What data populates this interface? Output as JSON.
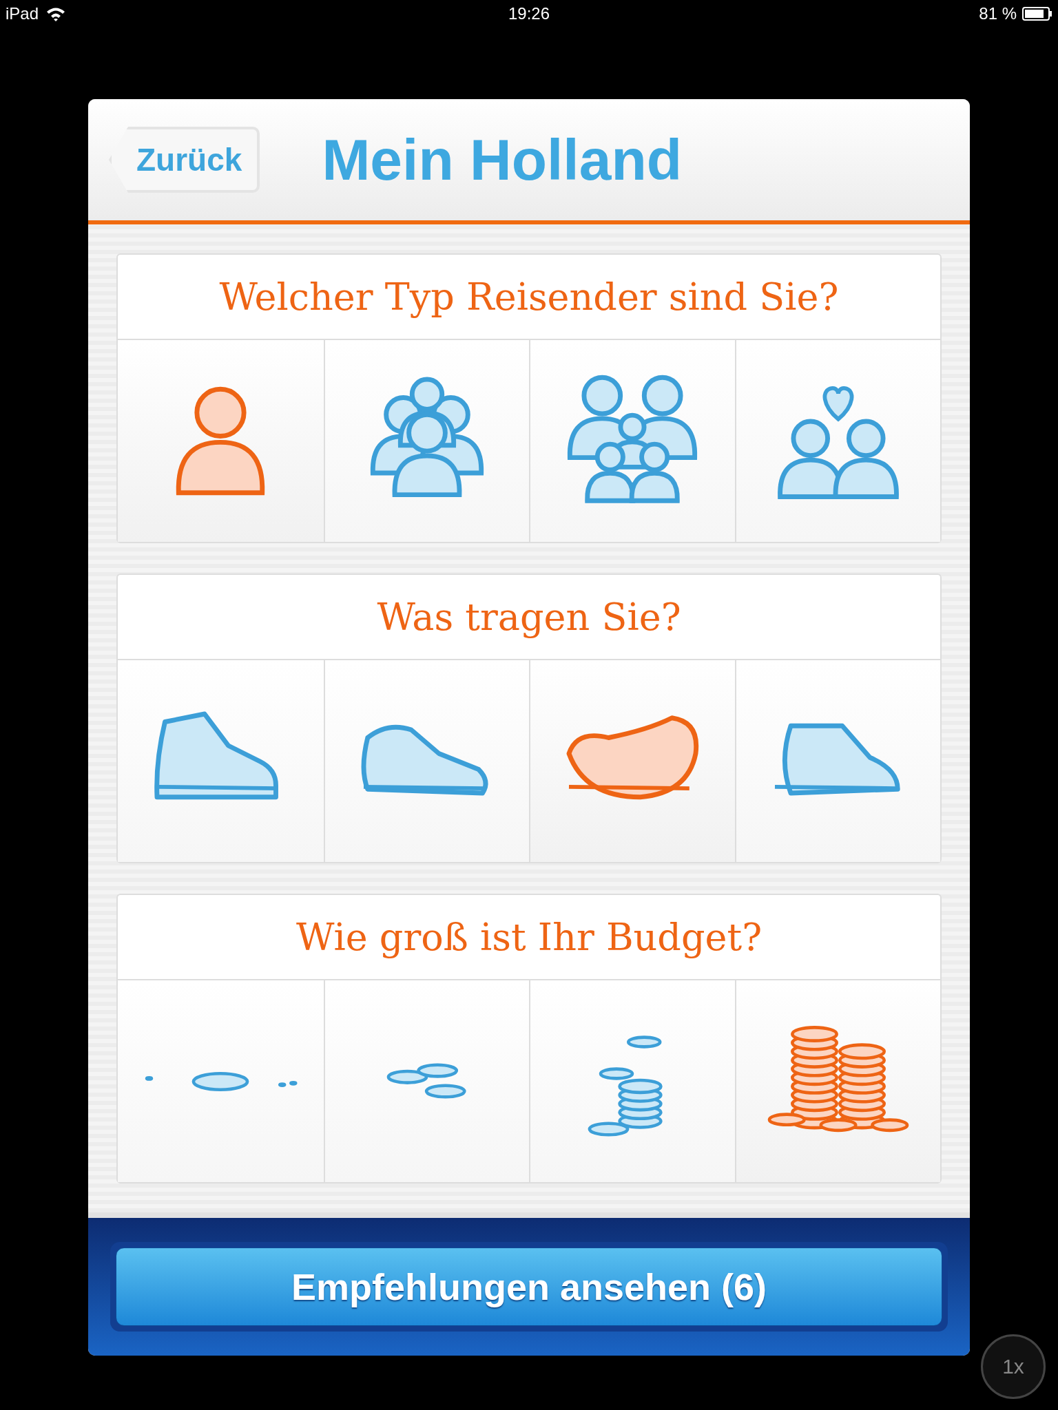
{
  "status_bar": {
    "device": "iPad",
    "time": "19:26",
    "battery": "81 %"
  },
  "header": {
    "back": "Zurück",
    "title": "Mein Holland"
  },
  "questions": [
    {
      "title": "Welcher Typ Reisender sind Sie?",
      "options": [
        {
          "kind": "solo",
          "selected": true
        },
        {
          "kind": "group",
          "selected": false
        },
        {
          "kind": "family",
          "selected": false
        },
        {
          "kind": "couple",
          "selected": false
        }
      ]
    },
    {
      "title": "Was tragen Sie?",
      "options": [
        {
          "kind": "boot",
          "selected": false
        },
        {
          "kind": "sneaker",
          "selected": false
        },
        {
          "kind": "clog",
          "selected": true
        },
        {
          "kind": "loafer",
          "selected": false
        }
      ]
    },
    {
      "title": "Wie groß ist Ihr Budget?",
      "options": [
        {
          "kind": "coins_few",
          "selected": false
        },
        {
          "kind": "coins_some",
          "selected": false
        },
        {
          "kind": "coins_more",
          "selected": false
        },
        {
          "kind": "coins_many",
          "selected": true
        }
      ]
    }
  ],
  "action_button": "Empfehlungen ansehen (6)",
  "zoom_button": "1x"
}
